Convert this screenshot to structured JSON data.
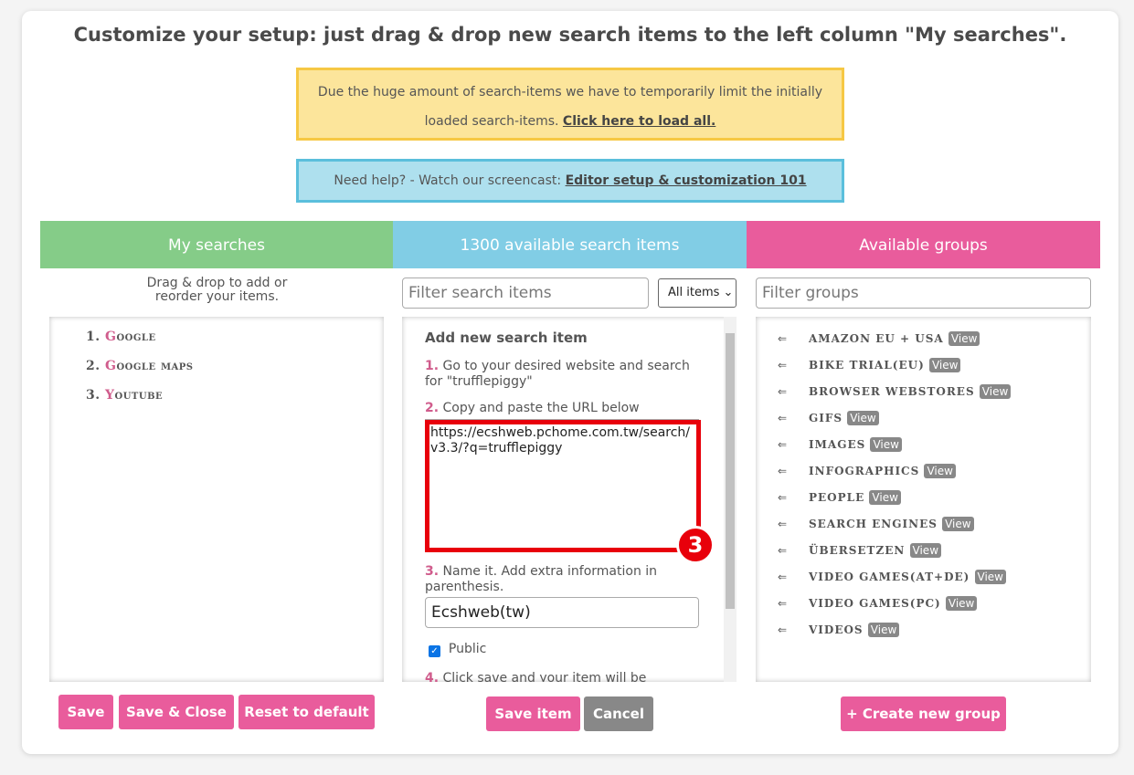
{
  "title": "Customize your setup: just drag & drop new search items to the left column \"My searches\".",
  "notice": {
    "text": "Due the huge amount of search-items we have to temporarily limit the initially loaded search-items.",
    "link": "Click here to load all."
  },
  "help": {
    "text": "Need help? - Watch our screencast:",
    "link": "Editor setup & customization 101"
  },
  "columns": {
    "my": {
      "header": "My searches",
      "hint": "Drag & drop to add or reorder your items.",
      "items": [
        {
          "n": "1.",
          "first": "G",
          "rest": "oogle"
        },
        {
          "n": "2.",
          "first": "G",
          "rest": "oogle maps"
        },
        {
          "n": "3.",
          "first": "Y",
          "rest": "outube"
        }
      ],
      "buttons": {
        "save": "Save",
        "save_close": "Save & Close",
        "reset": "Reset to default"
      }
    },
    "available": {
      "header": "1300 available search items",
      "filter_placeholder": "Filter search items",
      "select": "All items",
      "form": {
        "heading": "Add new search item",
        "step1_num": "1.",
        "step1": "Go to your desired website and search for \"trufflepiggy\"",
        "step2_num": "2.",
        "step2": "Copy and paste the URL below",
        "url": "https://ecshweb.pchome.com.tw/search/v3.3/?q=trufflepiggy",
        "step3_num": "3.",
        "step3": "Name it. Add extra information in parenthesis.",
        "name": "Ecshweb(tw)",
        "public_label": "Public",
        "public": true,
        "step4_num": "4.",
        "step4": "Click save and your item will be"
      },
      "annotation": "3",
      "buttons": {
        "save": "Save item",
        "cancel": "Cancel"
      }
    },
    "groups": {
      "header": "Available groups",
      "filter_placeholder": "Filter groups",
      "arrow": "⇐",
      "view": "View",
      "items": [
        "Amazon EU + USA",
        "Bike Trial(EU)",
        "Browser Webstores",
        "GIFs",
        "Images",
        "Infographics",
        "People",
        "Search engines",
        "Übersetzen",
        "Video Games(AT+DE)",
        "Video Games(PC)",
        "Videos"
      ],
      "create": "+ Create new group"
    }
  },
  "colors": {
    "green": "#85cc88",
    "blue": "#81cde5",
    "pink": "#e95c9c",
    "annotation": "#e8000b"
  }
}
